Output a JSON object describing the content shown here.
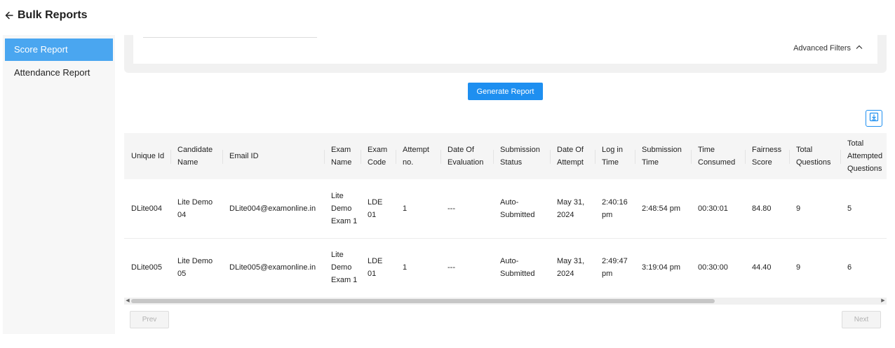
{
  "header": {
    "title": "Bulk Reports"
  },
  "sidebar": {
    "items": [
      {
        "label": "Score Report",
        "active": true
      },
      {
        "label": "Attendance Report",
        "active": false
      }
    ]
  },
  "filters": {
    "advanced_label": "Advanced Filters"
  },
  "actions": {
    "generate_label": "Generate Report"
  },
  "table": {
    "columns": [
      "Unique Id",
      "Candidate Name",
      "Email ID",
      "Exam Name",
      "Exam Code",
      "Attempt no.",
      "Date Of Evaluation",
      "Submission Status",
      "Date Of Attempt",
      "Log in Time",
      "Submission Time",
      "Time Consumed",
      "Fairness Score",
      "Total Questions",
      "Total Attempted Questions"
    ],
    "rows": [
      [
        "DLite004",
        "Lite Demo 04",
        "DLite004@examonline.in",
        "Lite Demo Exam 1",
        "LDE 01",
        "1",
        "---",
        "Auto-Submitted",
        "May 31, 2024",
        "2:40:16 pm",
        "2:48:54 pm",
        "00:30:01",
        "84.80",
        "9",
        "5"
      ],
      [
        "DLite005",
        "Lite Demo 05",
        "DLite005@examonline.in",
        "Lite Demo Exam 1",
        "LDE 01",
        "1",
        "---",
        "Auto-Submitted",
        "May 31, 2024",
        "2:49:47 pm",
        "3:19:04 pm",
        "00:30:00",
        "44.40",
        "9",
        "6"
      ]
    ]
  },
  "pagination": {
    "prev_label": "Prev",
    "next_label": "Next"
  },
  "colors": {
    "accent": "#1e8ff0",
    "sidebar_active": "#4aa6f0"
  }
}
